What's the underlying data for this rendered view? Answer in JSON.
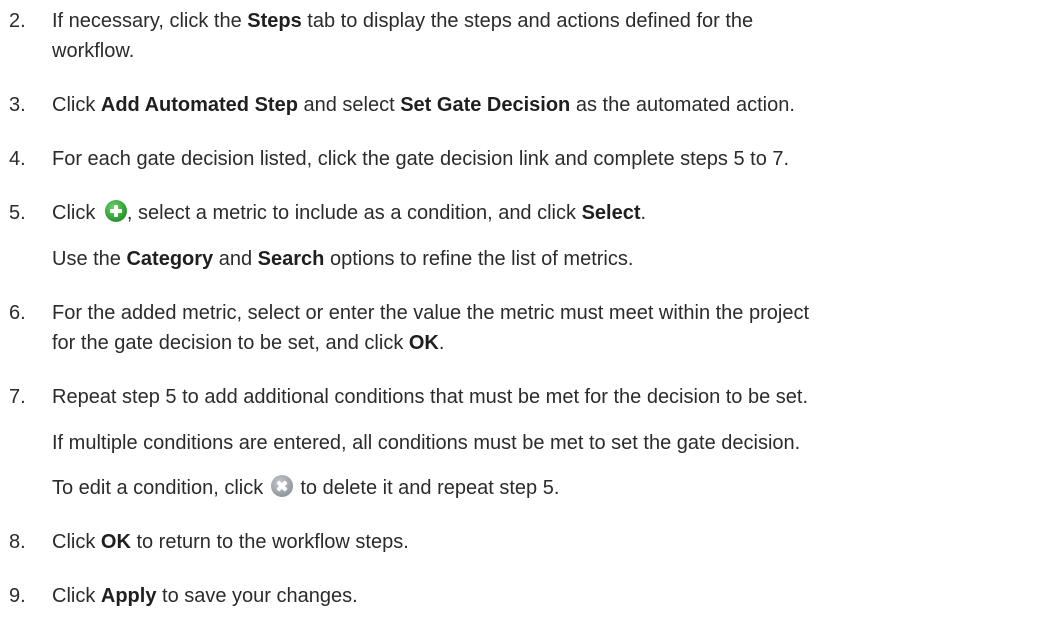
{
  "steps": [
    {
      "number": "2.",
      "line1": {
        "pre": "If necessary, click the ",
        "bold": "Steps",
        "post": " tab to display the steps and actions defined for the"
      },
      "line2": "workflow."
    },
    {
      "number": "3.",
      "pre": "Click ",
      "bold1": "Add Automated Step",
      "mid": " and select ",
      "bold2": "Set Gate Decision",
      "post": " as the automated action."
    },
    {
      "number": "4.",
      "text": "For each gate decision listed, click the gate decision link and complete steps 5 to 7."
    },
    {
      "number": "5.",
      "pre": "Click ",
      "icon": "add-circle-icon",
      "mid": ", select a metric to include as a condition, and click ",
      "bold": "Select",
      "post": ".",
      "note": {
        "pre": "Use the ",
        "bold1": "Category",
        "mid": " and ",
        "bold2": "Search",
        "post": " options to refine the list of metrics."
      }
    },
    {
      "number": "6.",
      "line1": "For the added metric, select or enter the value the metric must meet within the project",
      "line2": {
        "pre": "for the gate decision to be set, and click ",
        "bold": "OK",
        "post": "."
      }
    },
    {
      "number": "7.",
      "text": "Repeat step 5 to add additional conditions that must be met for the decision to be set.",
      "note1": "If multiple conditions are entered, all conditions must be met to set the gate decision.",
      "note2": {
        "pre": "To edit a condition, click ",
        "icon": "delete-circle-icon",
        "post": " to delete it and repeat step 5."
      }
    },
    {
      "number": "8.",
      "pre": "Click ",
      "bold": "OK",
      "post": " to return to the workflow steps."
    },
    {
      "number": "9.",
      "pre": "Click ",
      "bold": "Apply",
      "post": " to save your changes."
    }
  ]
}
